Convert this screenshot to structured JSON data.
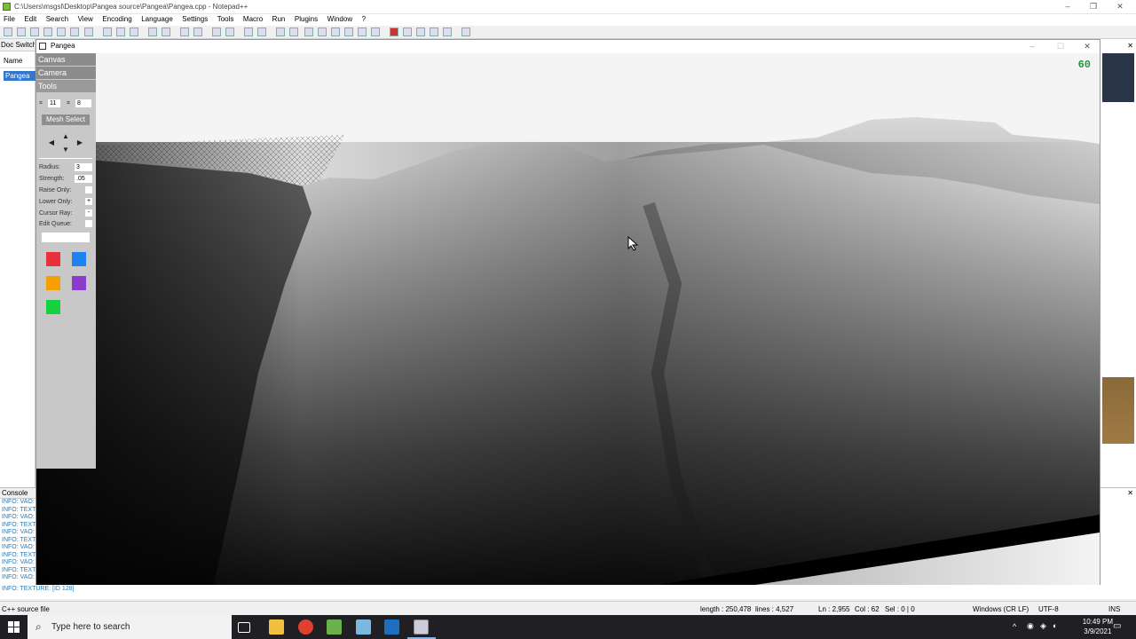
{
  "npp": {
    "title": "C:\\Users\\msgsl\\Desktop\\Pangea source\\Pangea\\Pangea.cpp - Notepad++",
    "menu": [
      "File",
      "Edit",
      "Search",
      "View",
      "Encoding",
      "Language",
      "Settings",
      "Tools",
      "Macro",
      "Run",
      "Plugins",
      "Window",
      "?"
    ],
    "doc_switcher": "Doc Switcher",
    "name_col": "Name",
    "open_file": "Pangea",
    "console_label": "Console",
    "console_lines": [
      "INFO: VAO:",
      "INFO: TEXT",
      "INFO: VAO:",
      "INFO: TEXT",
      "INFO: VAO:",
      "INFO: TEXT",
      "INFO: VAO:",
      "INFO: TEXT",
      "INFO: VAO:",
      "INFO: TEXT",
      "INFO: VAO:"
    ],
    "console_last": "INFO: TEXTURE: [ID 128]",
    "status": {
      "filetype": "C++ source file",
      "length": "length : 250,478",
      "lines": "lines : 4,527",
      "ln": "Ln : 2,955",
      "col": "Col : 62",
      "sel": "Sel : 0 | 0",
      "eol": "Windows (CR LF)",
      "enc": "UTF-8",
      "mode": "INS"
    }
  },
  "pangea": {
    "title": "Pangea",
    "fps": "60",
    "sections": [
      "Canvas",
      "Camera",
      "Tools"
    ],
    "grid_x": "11",
    "grid_y": "8",
    "mesh_select": "Mesh Select",
    "radius_label": "Radius:",
    "radius_value": "3",
    "strength_label": "Strength:",
    "strength_value": ".05",
    "raise_only": "Raise Only:",
    "lower_only": "Lower Only:",
    "lower_only_mark": "+",
    "cursor_ray": "Cursor Ray:",
    "cursor_ray_mark": "-",
    "edit_queue": "Edit Queue:",
    "swatches": [
      "#e8303a",
      "#1e82f0",
      "#f5a000",
      "#8a3ccc",
      "#14d23c"
    ]
  },
  "taskbar": {
    "search_placeholder": "Type here to search",
    "time": "10:49 PM",
    "date": "3/9/2021"
  }
}
